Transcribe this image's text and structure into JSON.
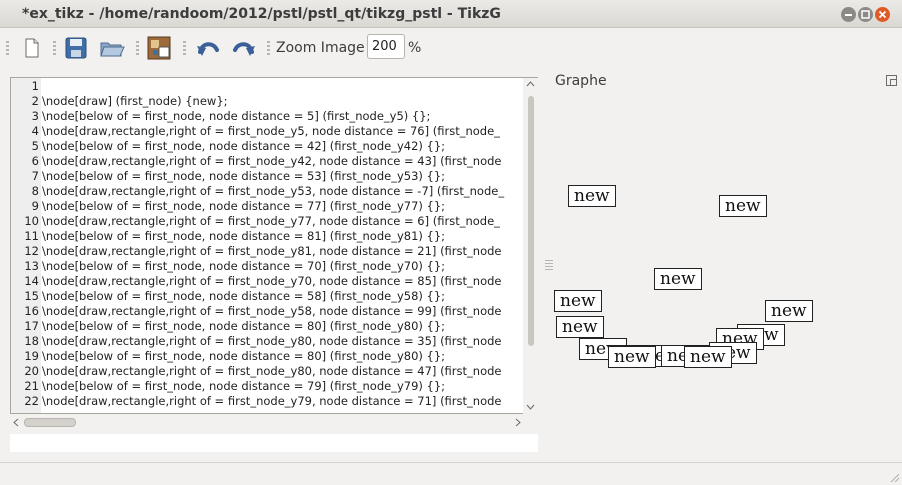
{
  "window": {
    "title": "*ex_tikz - /home/randoom/2012/pstl/pstl_qt/tikzg_pstl - TikzG"
  },
  "toolbar": {
    "zoom_label": "Zoom Image :",
    "zoom_value": "200",
    "zoom_unit": "%"
  },
  "editor": {
    "lines": [
      {
        "n": "1",
        "t": ""
      },
      {
        "n": "2",
        "t": "\\node[draw] (first_node) {new};"
      },
      {
        "n": "3",
        "t": "\\node[below of = first_node, node distance = 5] (first_node_y5) {};"
      },
      {
        "n": "4",
        "t": "\\node[draw,rectangle,right of = first_node_y5, node distance = 76] (first_node_"
      },
      {
        "n": "5",
        "t": "\\node[below of = first_node, node distance = 42] (first_node_y42) {};"
      },
      {
        "n": "6",
        "t": "\\node[draw,rectangle,right of = first_node_y42, node distance = 43] (first_node"
      },
      {
        "n": "7",
        "t": "\\node[below of = first_node, node distance = 53] (first_node_y53) {};"
      },
      {
        "n": "8",
        "t": "\\node[draw,rectangle,right of = first_node_y53, node distance = -7] (first_node_"
      },
      {
        "n": "9",
        "t": "\\node[below of = first_node, node distance = 77] (first_node_y77) {};"
      },
      {
        "n": "10",
        "t": "\\node[draw,rectangle,right of = first_node_y77, node distance = 6] (first_node_"
      },
      {
        "n": "11",
        "t": "\\node[below of = first_node, node distance = 81] (first_node_y81) {};"
      },
      {
        "n": "12",
        "t": "\\node[draw,rectangle,right of = first_node_y81, node distance = 21] (first_node"
      },
      {
        "n": "13",
        "t": "\\node[below of = first_node, node distance = 70] (first_node_y70) {};"
      },
      {
        "n": "14",
        "t": "\\node[draw,rectangle,right of = first_node_y70, node distance = 85] (first_node"
      },
      {
        "n": "15",
        "t": "\\node[below of = first_node, node distance = 58] (first_node_y58) {};"
      },
      {
        "n": "16",
        "t": "\\node[draw,rectangle,right of = first_node_y58, node distance = 99] (first_node"
      },
      {
        "n": "17",
        "t": "\\node[below of = first_node, node distance = 80] (first_node_y80) {};"
      },
      {
        "n": "18",
        "t": "\\node[draw,rectangle,right of = first_node_y80, node distance = 35] (first_node"
      },
      {
        "n": "19",
        "t": "\\node[below of = first_node, node distance = 80] (first_node_y80) {};"
      },
      {
        "n": "20",
        "t": "\\node[draw,rectangle,right of = first_node_y80, node distance = 47] (first_node"
      },
      {
        "n": "21",
        "t": "\\node[below of = first_node, node distance = 79] (first_node_y79) {};"
      },
      {
        "n": "22",
        "t": "\\node[draw,rectangle,right of = first_node_y79, node distance = 71] (first_node"
      }
    ]
  },
  "graph": {
    "title": "Graphe",
    "node_label": "new",
    "node_count": 15
  },
  "icons": {
    "new_file": "new-file-icon",
    "save": "save-icon",
    "open": "open-folder-icon",
    "compile": "tikz-compile-icon",
    "undo": "undo-icon",
    "redo": "redo-icon"
  }
}
